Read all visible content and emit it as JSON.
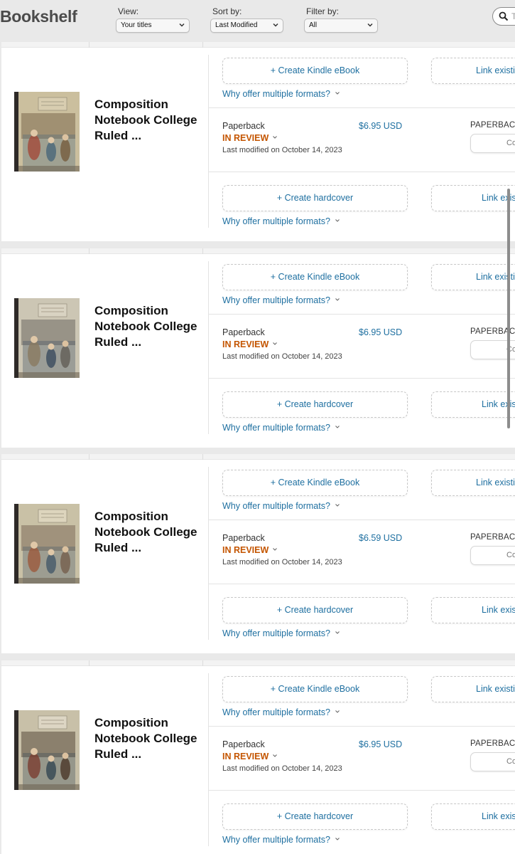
{
  "header": {
    "title": "Bookshelf",
    "view": {
      "label": "View:",
      "value": "Your titles"
    },
    "sort": {
      "label": "Sort by:",
      "value": "Last Modified"
    },
    "filter": {
      "label": "Filter by:",
      "value": "All"
    },
    "search_placeholder": "T"
  },
  "books": [
    {
      "title": "Composition Notebook College Ruled ...",
      "ebook_button": "+ Create Kindle eBook",
      "link_button": "Link existing",
      "why_text": "Why offer multiple formats?",
      "format": "Paperback",
      "status": "IN REVIEW",
      "modified": "Last modified on October 14, 2023",
      "price": "$6.95 USD",
      "type_label": "PAPERBACK",
      "mini_button": "Co",
      "hardcover_button": "+ Create hardcover",
      "link_button_2": "Link existing",
      "why_text_2": "Why offer multiple formats?"
    },
    {
      "title": "Composition Notebook College Ruled ...",
      "ebook_button": "+ Create Kindle eBook",
      "link_button": "Link existing",
      "why_text": "Why offer multiple formats?",
      "format": "Paperback",
      "status": "IN REVIEW",
      "modified": "Last modified on October 14, 2023",
      "price": "$6.95 USD",
      "type_label": "PAPERBACK",
      "mini_button": "Co",
      "hardcover_button": "+ Create hardcover",
      "link_button_2": "Link existing",
      "why_text_2": "Why offer multiple formats?"
    },
    {
      "title": "Composition Notebook College Ruled ...",
      "ebook_button": "+ Create Kindle eBook",
      "link_button": "Link existing",
      "why_text": "Why offer multiple formats?",
      "format": "Paperback",
      "status": "IN REVIEW",
      "modified": "Last modified on October 14, 2023",
      "price": "$6.59 USD",
      "type_label": "PAPERBACK",
      "mini_button": "Co",
      "hardcover_button": "+ Create hardcover",
      "link_button_2": "Link existing",
      "why_text_2": "Why offer multiple formats?"
    },
    {
      "title": "Composition Notebook College Ruled ...",
      "ebook_button": "+ Create Kindle eBook",
      "link_button": "Link existing",
      "why_text": "Why offer multiple formats?",
      "format": "Paperback",
      "status": "IN REVIEW",
      "modified": "Last modified on October 14, 2023",
      "price": "$6.95 USD",
      "type_label": "PAPERBACK",
      "mini_button": "Co",
      "hardcover_button": "+ Create hardcover",
      "link_button_2": "Link existing",
      "why_text_2": "Why offer multiple formats?"
    }
  ],
  "icons": {
    "search": "search-icon",
    "dropdown": "chevron-down-icon"
  },
  "colors": {
    "link": "#1e6fa0",
    "status": "#c45500",
    "page_bg": "#e9e9e9"
  }
}
